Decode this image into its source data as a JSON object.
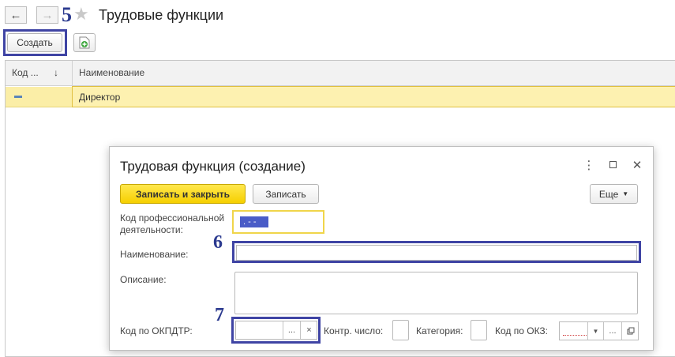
{
  "nav": {
    "back_glyph": "🡐",
    "forward_glyph": "🡒",
    "marker": "5",
    "title": "Трудовые функции"
  },
  "toolbar": {
    "create_label": "Создать"
  },
  "table": {
    "columns": [
      "Код ...",
      "Наименование"
    ],
    "sort_glyph": "↓",
    "rows": [
      {
        "code": "",
        "name": "Директор"
      }
    ]
  },
  "dialog": {
    "title": "Трудовая функция (создание)",
    "save_close_label": "Записать и закрыть",
    "save_label": "Записать",
    "more_label": "Еще",
    "fields": {
      "prof_code_label": "Код профессиональной деятельности:",
      "prof_code_value": ". - -",
      "name_label": "Наименование:",
      "name_value": "",
      "description_label": "Описание:",
      "description_value": "",
      "okpdtr_label": "Код по ОКПДТР:",
      "check_number_label": "Контр. число:",
      "category_label": "Категория:",
      "okz_label": "Код по ОКЗ:"
    }
  },
  "markers": {
    "name_marker": "6",
    "okpdtr_marker": "7"
  },
  "colors": {
    "highlight_frame": "#3f44a4",
    "primary_button": "#f6cf00",
    "selected_row": "#fbeea7"
  }
}
